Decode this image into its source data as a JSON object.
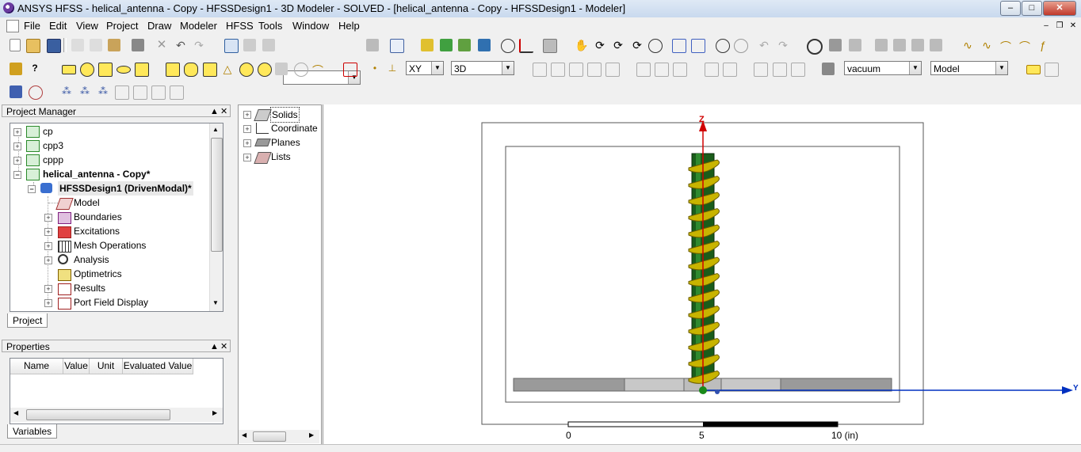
{
  "window": {
    "title": "ANSYS HFSS - helical_antenna - Copy - HFSSDesign1 - 3D Modeler - SOLVED - [helical_antenna - Copy - HFSSDesign1 - Modeler]",
    "controls": {
      "minimize": "–",
      "maximize": "□",
      "close": "✕"
    }
  },
  "menu": {
    "items": [
      "File",
      "Edit",
      "View",
      "Project",
      "Draw",
      "Modeler",
      "HFSS",
      "Tools",
      "Window",
      "Help"
    ],
    "mdi": {
      "minimize": "–",
      "restore": "❐",
      "close": "✕"
    }
  },
  "toolbar": {
    "plane": "XY",
    "dimension": "3D",
    "material": "vacuum",
    "view_mode": "Model",
    "blank_combo": ""
  },
  "project_manager": {
    "title": "Project Manager",
    "pin": "▲",
    "close": "✕",
    "tab": "Project",
    "projects": [
      "cp",
      "cpp3",
      "cppp",
      "helical_antenna - Copy*"
    ],
    "design": "HFSSDesign1 (DrivenModal)*",
    "nodes": [
      "Model",
      "Boundaries",
      "Excitations",
      "Mesh Operations",
      "Analysis",
      "Optimetrics",
      "Results",
      "Port Field Display"
    ]
  },
  "properties": {
    "title": "Properties",
    "pin": "▲",
    "close": "✕",
    "columns": [
      "Name",
      "Value",
      "Unit",
      "Evaluated Value"
    ],
    "tab": "Variables"
  },
  "model_tree": {
    "items": [
      "Solids",
      "Coordinate",
      "Planes",
      "Lists"
    ]
  },
  "viewport": {
    "axis_z": "Z",
    "axis_y": "Y",
    "scale_labels": [
      "0",
      "5",
      "10 (in)"
    ],
    "colors": {
      "helix": "#c8b400",
      "post": "#1a5c1a",
      "ground": "#a0a0a0",
      "axis_z": "#d00000",
      "axis_y": "#0030c0"
    }
  }
}
